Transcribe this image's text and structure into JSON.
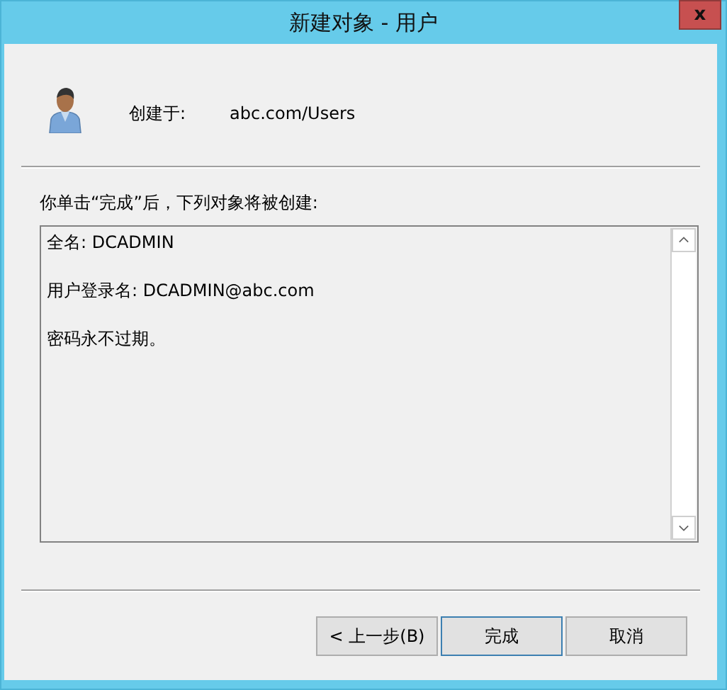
{
  "window": {
    "title": "新建对象 - 用户",
    "close": "x"
  },
  "created_in": {
    "label": "创建于:",
    "value": "abc.com/Users"
  },
  "instruction": "你单击“完成”后，下列对象将被创建:",
  "summary_lines": [
    "全名: DCADMIN",
    "用户登录名: DCADMIN@abc.com",
    "密码永不过期。"
  ],
  "buttons": [
    {
      "label": "< 上一步(B)",
      "default": false
    },
    {
      "label": "完成",
      "default": true
    },
    {
      "label": "取消",
      "default": false
    }
  ]
}
